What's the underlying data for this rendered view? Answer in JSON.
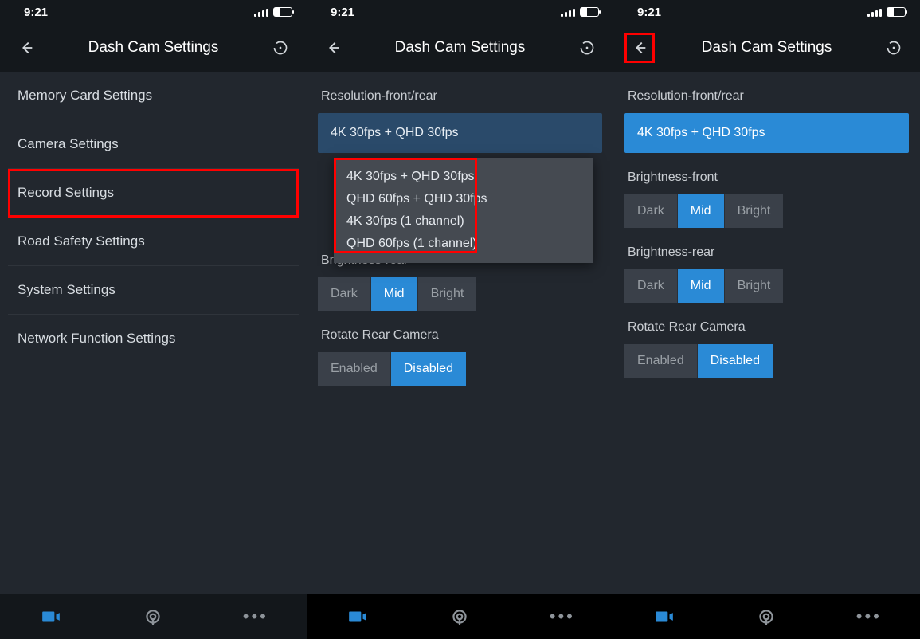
{
  "statusbar": {
    "time": "9:21"
  },
  "header": {
    "title": "Dash Cam Settings"
  },
  "settings_list": {
    "items": [
      {
        "label": "Memory Card Settings"
      },
      {
        "label": "Camera Settings"
      },
      {
        "label": "Record Settings"
      },
      {
        "label": "Road Safety Settings"
      },
      {
        "label": "System Settings"
      },
      {
        "label": "Network Function Settings"
      }
    ],
    "highlighted_index": 2
  },
  "record": {
    "resolution_label": "Resolution-front/rear",
    "resolution_value": "4K 30fps + QHD 30fps",
    "resolution_options": [
      "4K 30fps + QHD 30fps",
      "QHD 60fps + QHD 30fps",
      "4K 30fps (1 channel)",
      "QHD 60fps (1 channel)"
    ],
    "brightness_front_label": "Brightness-front",
    "brightness_rear_label": "Brightness-rear",
    "brightness_options": [
      "Dark",
      "Mid",
      "Bright"
    ],
    "brightness_front_active": 1,
    "brightness_rear_active": 1,
    "rotate_label": "Rotate Rear Camera",
    "rotate_options": [
      "Enabled",
      "Disabled"
    ],
    "rotate_active": 1
  }
}
